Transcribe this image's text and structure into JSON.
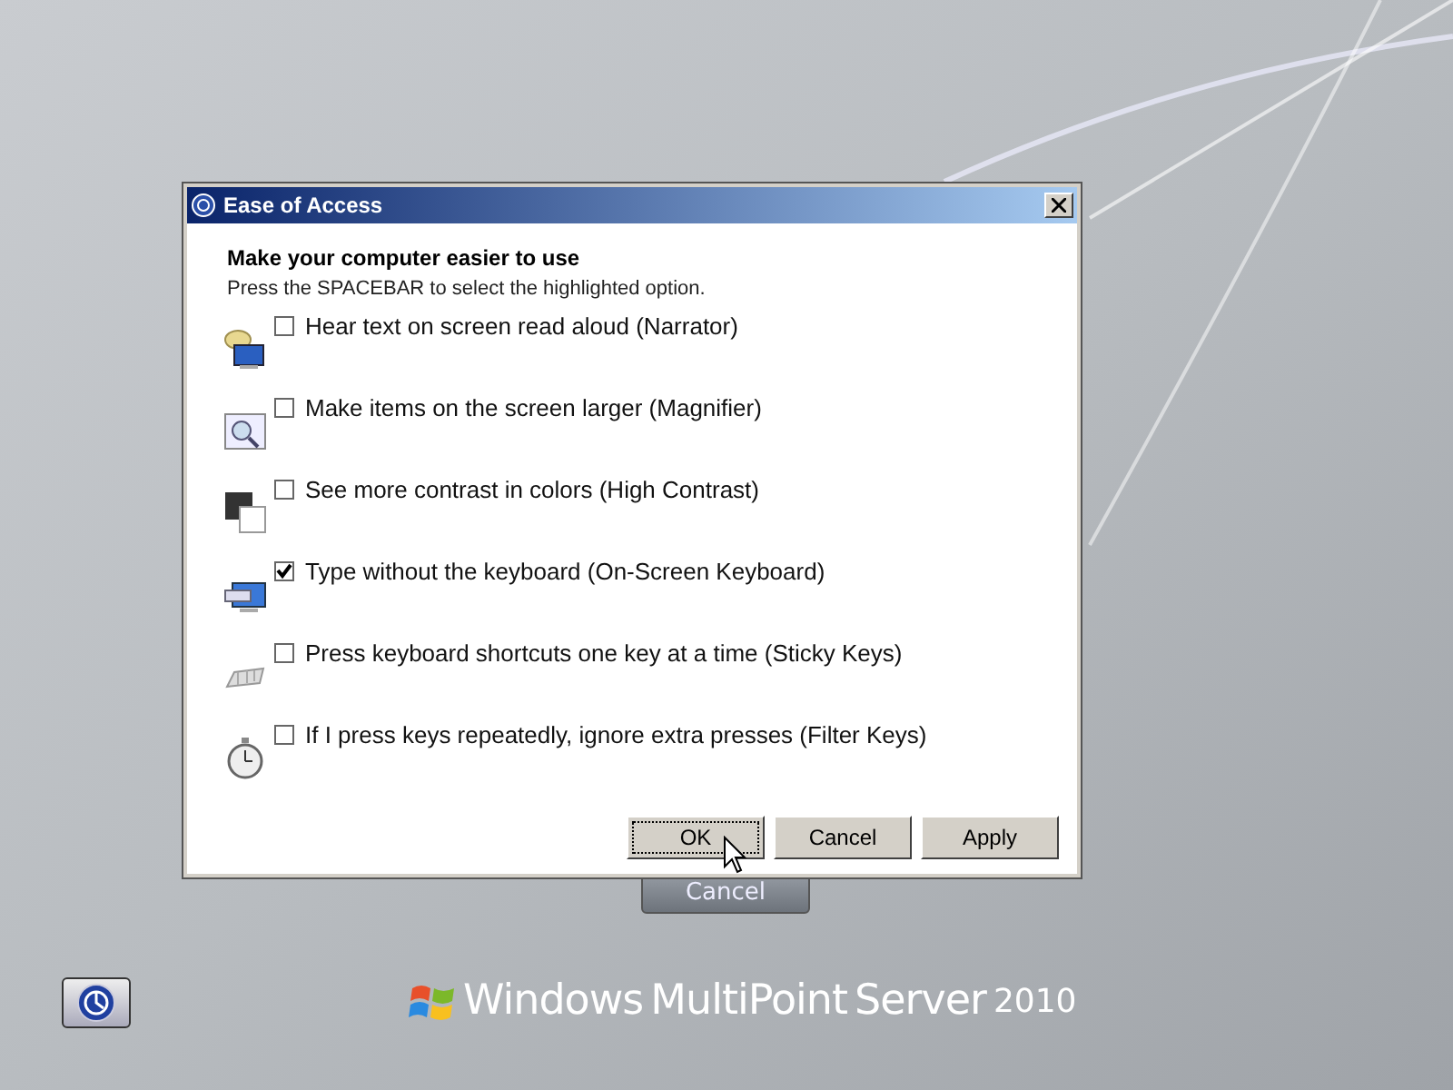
{
  "background_button": {
    "label": "Cancel"
  },
  "dialog": {
    "title": "Ease of Access",
    "heading": "Make your computer easier to use",
    "instruction": "Press the SPACEBAR to select the highlighted option.",
    "options": [
      {
        "kind": "narrator",
        "label": "Hear text on screen read aloud (Narrator)",
        "checked": false
      },
      {
        "kind": "magnifier",
        "label": "Make items on the screen larger (Magnifier)",
        "checked": false
      },
      {
        "kind": "contrast",
        "label": "See more contrast in colors (High Contrast)",
        "checked": false
      },
      {
        "kind": "keyboard",
        "label": "Type without the keyboard (On-Screen Keyboard)",
        "checked": true
      },
      {
        "kind": "sticky",
        "label": "Press keyboard shortcuts one key at a time (Sticky Keys)",
        "checked": false
      },
      {
        "kind": "filter",
        "label": "If I press keys repeatedly, ignore extra presses (Filter Keys)",
        "checked": false
      }
    ],
    "buttons": [
      {
        "label": "OK",
        "focused": true
      },
      {
        "label": "Cancel",
        "focused": false
      },
      {
        "label": "Apply",
        "focused": false
      }
    ]
  },
  "branding": {
    "product": "Windows",
    "name": "MultiPoint",
    "edition": "Server",
    "year": "2010"
  }
}
